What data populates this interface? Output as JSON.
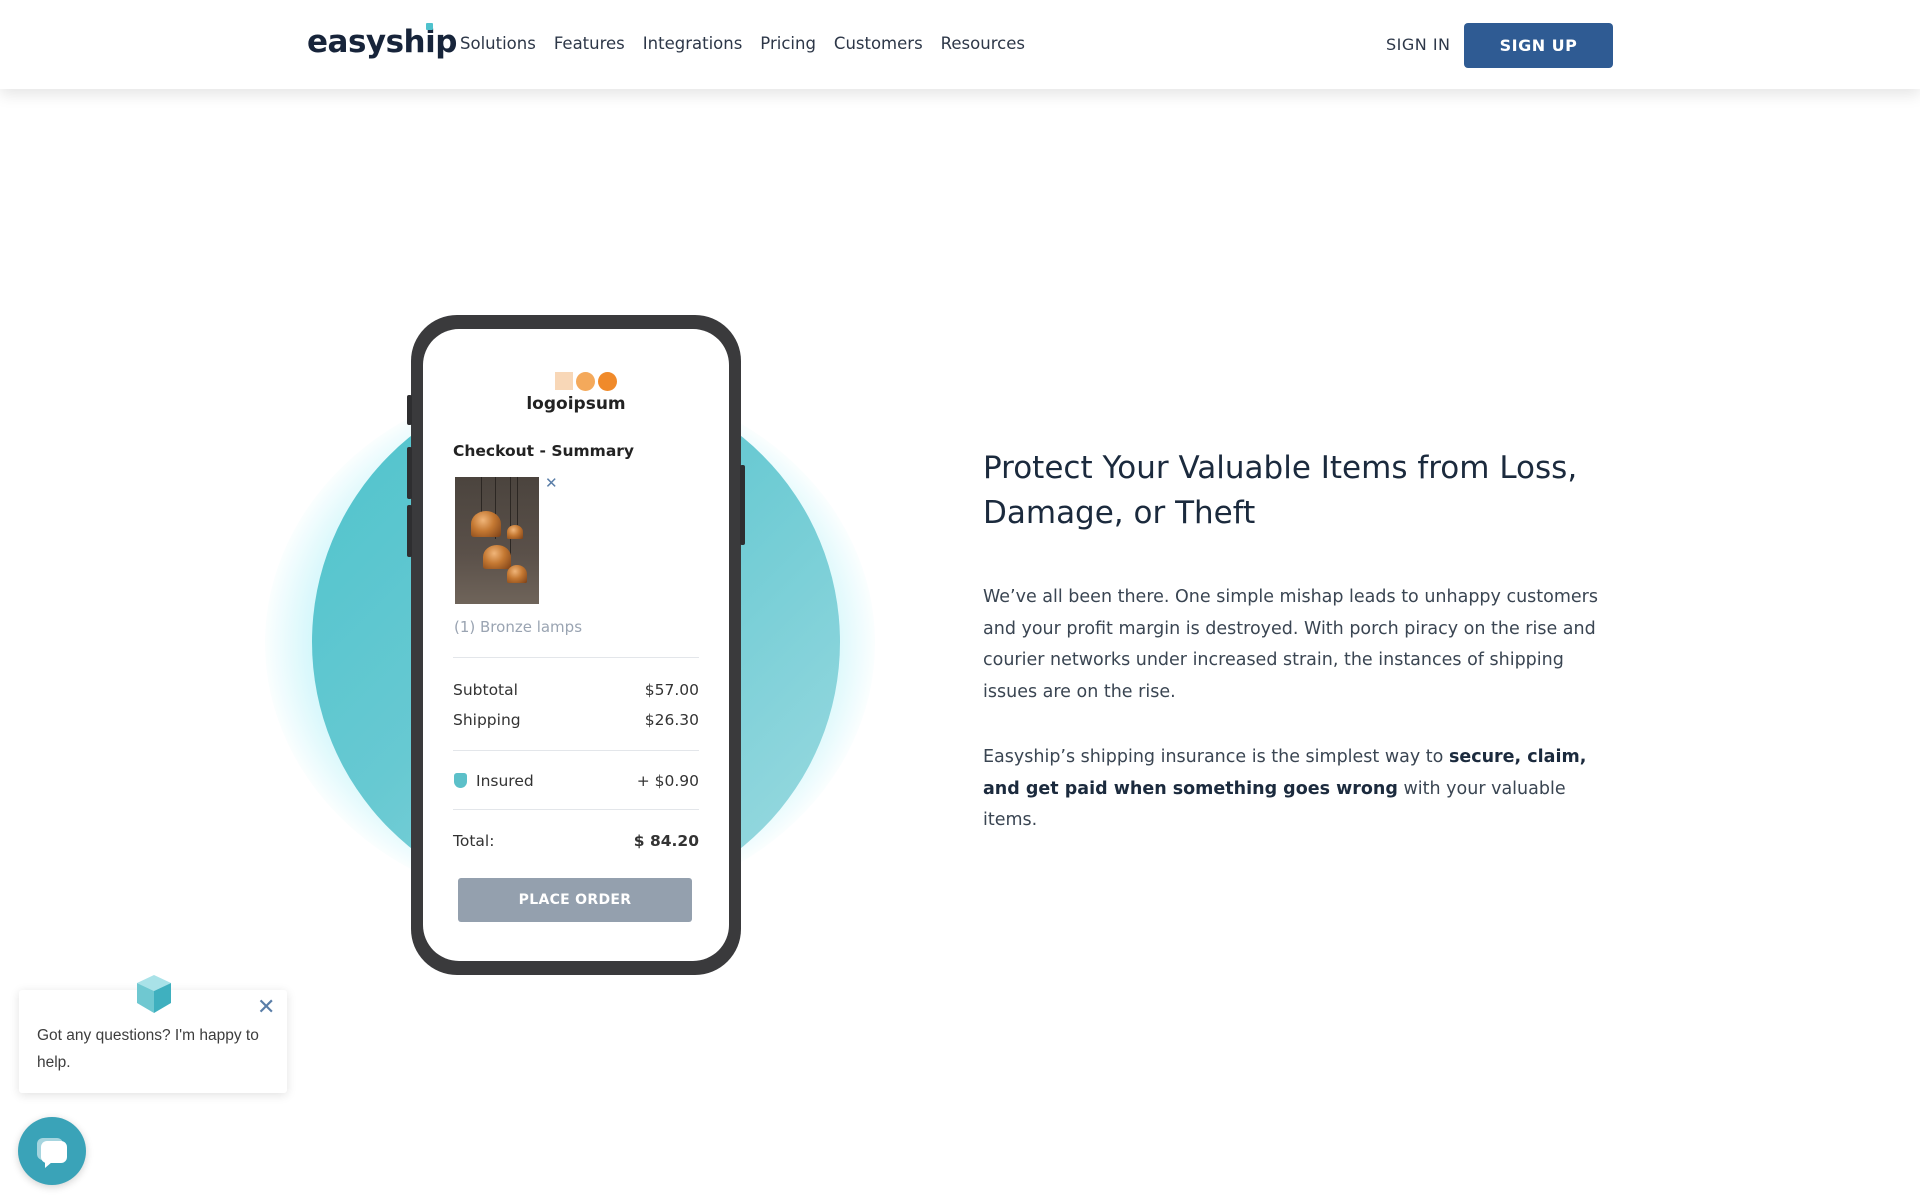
{
  "header": {
    "logo": "easyship",
    "nav": [
      "Solutions",
      "Features",
      "Integrations",
      "Pricing",
      "Customers",
      "Resources"
    ],
    "sign_in": "SIGN IN",
    "sign_up": "SIGN UP"
  },
  "phone": {
    "brand": "logoipsum",
    "checkout_title": "Checkout - Summary",
    "remove_icon": "close-icon",
    "product_label": "(1) Bronze lamps",
    "subtotal_label": "Subtotal",
    "subtotal_value": "$57.00",
    "shipping_label": "Shipping",
    "shipping_value": "$26.30",
    "insured_label": "Insured",
    "insured_value": "+ $0.90",
    "total_label": "Total:",
    "total_value": "$ 84.20",
    "place_order": "PLACE ORDER"
  },
  "copy": {
    "headline": "Protect Your Valuable Items from Loss, Damage, or Theft",
    "para1": "We’ve all been there. One simple mishap leads to unhappy customers and your profit margin is destroyed. With porch piracy on the rise and courier networks under increased strain, the instances of shipping issues are on the rise.",
    "para2_start": "Easyship’s shipping insurance is the simplest way to ",
    "para2_bold": "secure, claim, and get paid when something goes wrong",
    "para2_end": " with your valuable items."
  },
  "chat": {
    "message": "Got any questions? I'm happy to help.",
    "close_icon": "close-icon",
    "launcher_icon": "chat-icon"
  },
  "colors": {
    "brand_blue": "#2f5b93",
    "teal": "#4ec3cc",
    "button_gray": "#94a0ae"
  }
}
